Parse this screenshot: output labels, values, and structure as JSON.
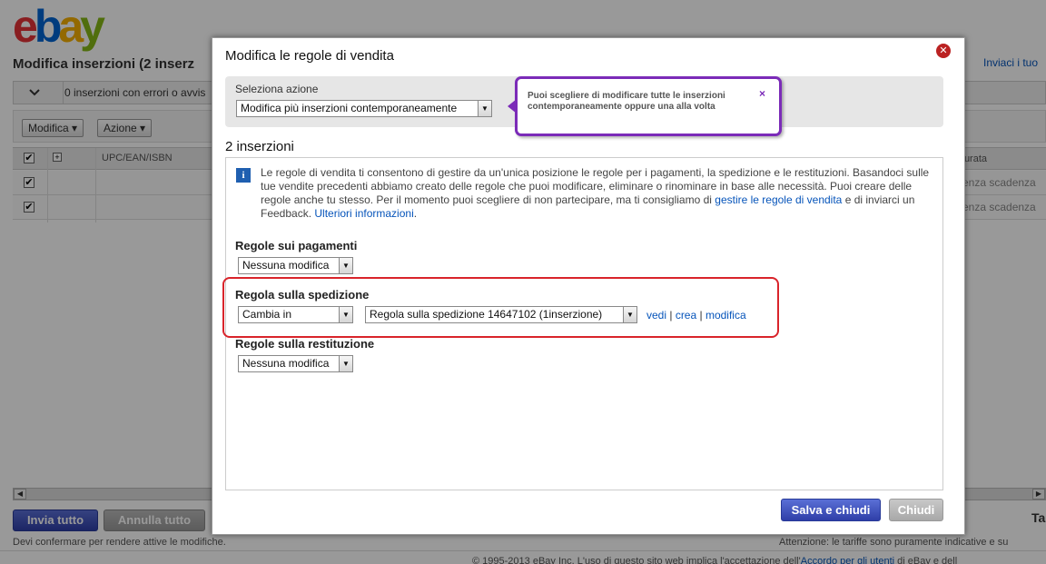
{
  "logo": [
    "e",
    "b",
    "a",
    "y"
  ],
  "background": {
    "page_title": "Modifica inserzioni (2 inserz",
    "top_link": "Inviaci i tuo",
    "error_bar_text": "0 inserzioni con errori o avvis",
    "modifica_button": "Modifica ▾",
    "azione_button": "Azione ▾",
    "col_upc": "UPC/EAN/ISBN",
    "col_durata": "Durata",
    "row_durata": [
      "Senza scadenza",
      "Senza scadenza"
    ],
    "invia_tutto": "Invia tutto",
    "annulla_tutto": "Annulla tutto",
    "confirm_text": "Devi confermare per rendere attive le modifiche.",
    "tariffe_text": "Attenzione: le tariffe sono puramente indicative e su",
    "ta_text": "Ta",
    "footer_text": "© 1995-2013 eBay Inc. L'uso di questo sito web implica l'accettazione dell'",
    "footer_link": "Accordo per gli utenti",
    "footer_text_end": " di eBay e dell"
  },
  "modal": {
    "title": "Modifica le regole di vendita",
    "close_icon": "close-icon",
    "action_label": "Seleziona azione",
    "action_value": "Modifica più inserzioni contemporaneamente",
    "tooltip_text": "Puoi scegliere di modificare tutte le inserzioni contemporaneamente oppure una alla volta",
    "tooltip_close": "×",
    "count_title": "2 inserzioni",
    "info_text": "Le regole di vendita ti consentono di gestire da un'unica posizione le regole per i pagamenti, la spedizione e le restituzioni. Basandoci sulle tue vendite precedenti abbiamo creato delle regole che puoi modificare, eliminare o rinominare in base alle necessità. Puoi creare delle regole anche tu stesso. Per il momento puoi scegliere di non partecipare, ma ti consigliamo di ",
    "info_link_manage": "gestire le regole di vendita",
    "info_text_mid": " e di inviarci un Feedback. ",
    "info_link_more": "Ulteriori informazioni",
    "info_text_end": ".",
    "payments_label": "Regole sui pagamenti",
    "payments_value": "Nessuna modifica",
    "shipping_label": "Regola sulla spedizione",
    "shipping_action": "Cambia in",
    "shipping_policy": "Regola sulla spedizione 14647102 (1inserzione)",
    "link_vedi": "vedi",
    "link_crea": "crea",
    "link_modifica": "modifica",
    "link_sep": " | ",
    "returns_label": "Regole sulla restituzione",
    "returns_value": "Nessuna modifica",
    "save_button": "Salva e chiudi",
    "close_button": "Chiudi"
  },
  "colors": {
    "accent_blue": "#2f3fa8",
    "tooltip_border": "#7b2bb8",
    "highlight_red": "#d9242b",
    "link": "#0654ba"
  }
}
